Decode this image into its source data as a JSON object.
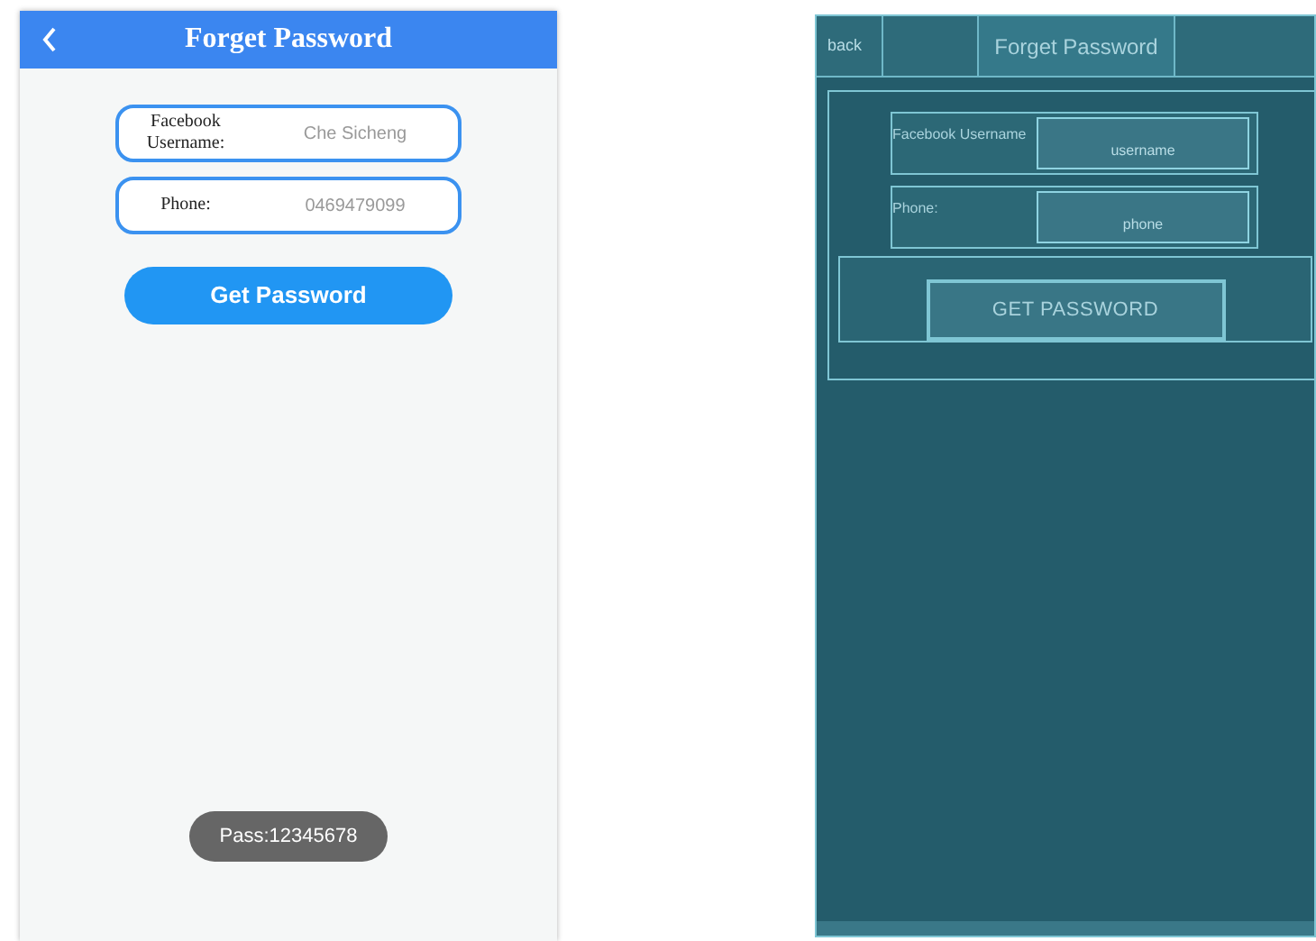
{
  "app": {
    "title": "Forget Password",
    "fields": [
      {
        "label": "Facebook Username:",
        "value": "Che Sicheng"
      },
      {
        "label": "Phone:",
        "value": "0469479099"
      }
    ],
    "button": "Get Password",
    "toast": "Pass:12345678"
  },
  "layout_preview": {
    "back": "back",
    "title": "Forget Password",
    "fields": [
      {
        "label": "Facebook Username",
        "placeholder": "username"
      },
      {
        "label": "Phone:",
        "placeholder": "phone"
      }
    ],
    "button": "GET PASSWORD"
  }
}
